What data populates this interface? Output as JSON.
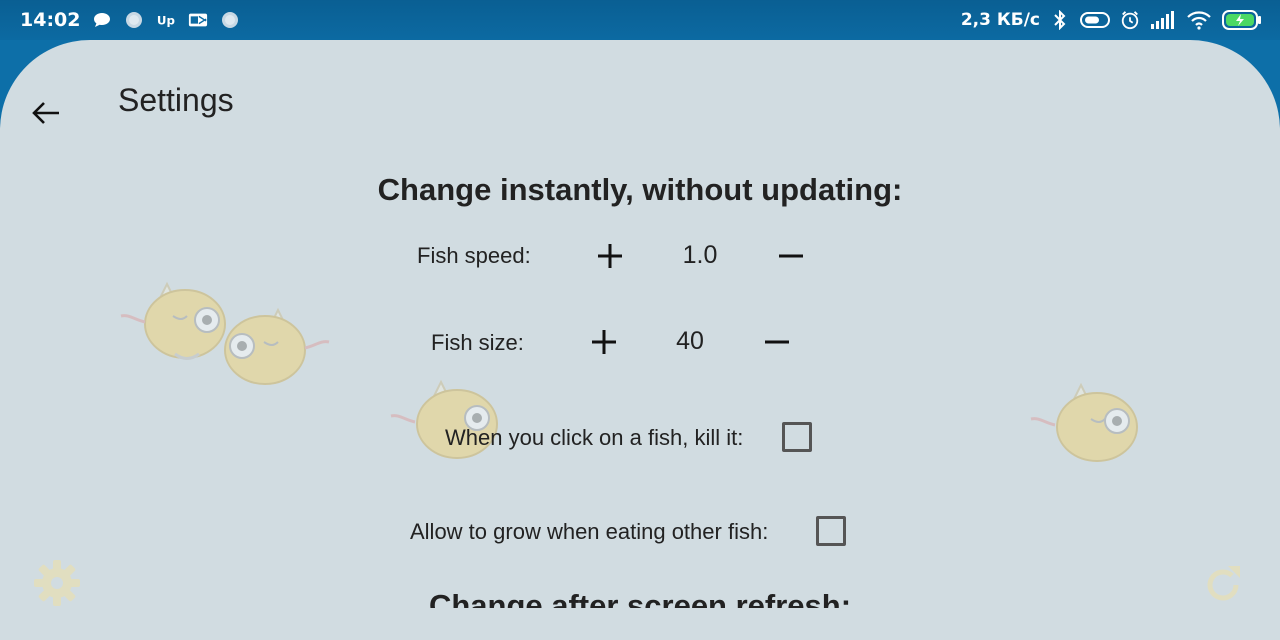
{
  "status_bar": {
    "time": "14:02",
    "left_icons": [
      "message-icon",
      "notification-icon",
      "up-app-icon",
      "outlook-icon",
      "notification-icon"
    ],
    "net_speed": "2,3 КБ/с",
    "right_icons": [
      "bluetooth-icon",
      "toggle-icon",
      "alarm-icon",
      "signal-icon",
      "wifi-icon",
      "battery-icon"
    ]
  },
  "header": {
    "title": "Settings"
  },
  "instant_section": {
    "title": "Change instantly, without updating:",
    "fish_speed": {
      "label": "Fish speed:",
      "value": "1.0"
    },
    "fish_size": {
      "label": "Fish size:",
      "value": "40"
    },
    "kill_on_click": {
      "label": "When you click on a fish, kill it:",
      "checked": false
    },
    "grow_on_eat": {
      "label": "Allow to grow when eating other fish:",
      "checked": false
    }
  },
  "refresh_section": {
    "title": "Change after screen refresh:"
  },
  "colors": {
    "accent_icon": "#f0e0a8",
    "background": "#d1dce1",
    "status_bar": "#0c6aa2"
  }
}
